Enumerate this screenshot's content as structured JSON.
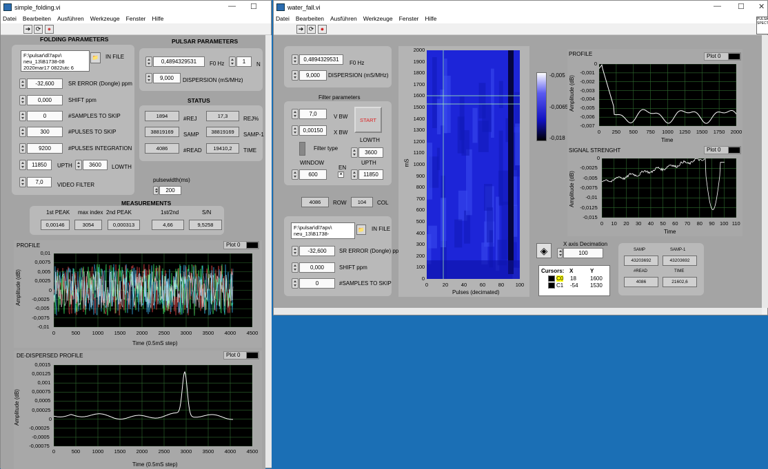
{
  "left_window": {
    "title": "simple_folding.vi",
    "menu": [
      "Datei",
      "Bearbeiten",
      "Ausführen",
      "Werkzeuge",
      "Fenster",
      "Hilfe"
    ],
    "folding": {
      "header": "FOLDING PARAMETERS",
      "in_file_label": "IN FILE",
      "in_file_value": "F:\\pulsar\\dl7apv\\ neu_13\\B1738-08 2020mar17 0822utc 6",
      "sr_error": {
        "value": "-32,600",
        "label": "SR ERROR (Dongle) ppm"
      },
      "shift": {
        "value": "0,000",
        "label": "SHIFT ppm"
      },
      "samples_skip": {
        "value": "0",
        "label": "#SAMPLES TO SKIP"
      },
      "pulses_skip": {
        "value": "300",
        "label": "#PULSES TO SKIP"
      },
      "pulses_int": {
        "value": "9200",
        "label": "#PULSES INTEGRATION"
      },
      "upth": {
        "value": "11850",
        "label": "UPTH"
      },
      "lowth": {
        "value": "3600",
        "label": "LOWTH"
      },
      "video": {
        "value": "7,0",
        "label": "VIDEO FILTER"
      }
    },
    "pulsar": {
      "header": "PULSAR PARAMETERS",
      "f0": {
        "value": "0,4894329531",
        "label": "F0 Hz"
      },
      "n": {
        "value": "1",
        "label": "N"
      },
      "dispersion": {
        "value": "9,000",
        "label": "DISPERSION (mS/MHz)"
      }
    },
    "status": {
      "header": "STATUS",
      "rej": "1894",
      "rej_label": "#REJ",
      "rej_pct": "17,3",
      "rej_pct_label": "REJ%",
      "samp": "38819169",
      "samp_label": "SAMP",
      "samp1": "38819169",
      "samp1_label": "SAMP-1",
      "read": "4086",
      "read_label": "#READ",
      "time": "19410,2",
      "time_label": "TIME"
    },
    "pulsewidth": {
      "label": "pulsewidth(ms)",
      "value": "200"
    },
    "measurements": {
      "header": "MEASUREMENTS",
      "labels": [
        "1st PEAK",
        "max index",
        "2nd PEAK",
        "1st/2nd",
        "S/N"
      ],
      "values": [
        "0,00146",
        "3054",
        "0,000313",
        "4,66",
        "9,5258"
      ]
    },
    "profile": {
      "title": "PROFILE",
      "plot": "Plot 0",
      "ylabel": "Amplitude (dB)",
      "xlabel": "Time (0.5mS step)",
      "yticks": [
        "0,01",
        "0,0075",
        "0,005",
        "0,0025",
        "0",
        "-0,0025",
        "-0,005",
        "-0,0075",
        "-0,01"
      ],
      "xticks": [
        "0",
        "500",
        "1000",
        "1500",
        "2000",
        "2500",
        "3000",
        "3500",
        "4000",
        "4500"
      ]
    },
    "dedispersed": {
      "title": "DE-DISPERSED PROFILE",
      "plot": "Plot 0",
      "ylabel": "Amplitude (dB)",
      "xlabel": "Time (0.5mS step)",
      "yticks": [
        "0,0015",
        "0,00125",
        "0,001",
        "0,00075",
        "0,0005",
        "0,00025",
        "0",
        "-0,00025",
        "-0,0005",
        "-0,00075"
      ],
      "xticks": [
        "0",
        "500",
        "1000",
        "1500",
        "2000",
        "2500",
        "3000",
        "3500",
        "4000",
        "4500"
      ]
    }
  },
  "right_window": {
    "title": "water_fall.vi",
    "menu": [
      "Datei",
      "Bearbeiten",
      "Ausführen",
      "Werkzeuge",
      "Fenster",
      "Hilfe"
    ],
    "corner_label": "PULSAR SPECT",
    "params": {
      "f0": {
        "value": "0,4894329531",
        "label": "F0 Hz"
      },
      "dispersion": {
        "value": "9,000",
        "label": "DISPERSION (mS/MHz)"
      }
    },
    "filter": {
      "header": "Filter parameters",
      "vbw": {
        "value": "7,0",
        "label": "V BW"
      },
      "xbw": {
        "value": "0,00150",
        "label": "X BW"
      },
      "start": "START",
      "lowth_label": "LOWTH",
      "lowth": "3600",
      "type_label": "Filter type",
      "window_label": "WINDOW",
      "window": "600",
      "en_label": "EN",
      "upth_label": "UPTH",
      "upth": "11850"
    },
    "row_col": {
      "row": "4086",
      "row_label": "ROW",
      "col": "104",
      "col_label": "COL"
    },
    "file": {
      "in_file_label": "IN FILE",
      "in_file_value": "F:\\pulsar\\dl7apv\\ neu_13\\B1738-",
      "sr_error": {
        "value": "-32,600",
        "label": "SR ERROR (Dongle) ppm"
      },
      "shift": {
        "value": "0,000",
        "label": "SHIFT ppm"
      },
      "samples_skip": {
        "value": "0",
        "label": "#SAMPLES TO SKIP"
      }
    },
    "waterfall": {
      "ylabel": "mS",
      "xlabel": "Pulses (decimated)",
      "yticks": [
        "2000",
        "1900",
        "1800",
        "1700",
        "1600",
        "1500",
        "1400",
        "1300",
        "1200",
        "1100",
        "1000",
        "900",
        "800",
        "700",
        "600",
        "500",
        "400",
        "300",
        "200",
        "100",
        "0"
      ],
      "xticks": [
        "0",
        "20",
        "40",
        "60",
        "80",
        "100"
      ],
      "colorscale": [
        "-0,005",
        "-0,0065",
        "-0,018"
      ]
    },
    "cursors": {
      "header": "Cursors:",
      "x": "X",
      "y": "Y",
      "rows": [
        {
          "name": "C0",
          "x": "18",
          "y": "1600"
        },
        {
          "name": "C1",
          "x": "-54",
          "y": "1530"
        }
      ]
    },
    "decimation": {
      "label": "X axis Decimation",
      "value": "100"
    },
    "stats": {
      "samp_label": "SAMP",
      "samp": "43203692",
      "samp1_label": "SAMP-1",
      "samp1": "43203692",
      "read_label": "#READ",
      "read": "4086",
      "time_label": "TIME",
      "time": "21602,6"
    },
    "profile": {
      "title": "PROFILE",
      "plot": "Plot 0",
      "ylabel": "Amplitude (dB)",
      "xlabel": "Time",
      "yticks": [
        "0",
        "-0,001",
        "-0,002",
        "-0,003",
        "-0,004",
        "-0,005",
        "-0,006",
        "-0,007"
      ],
      "xticks": [
        "0",
        "250",
        "500",
        "750",
        "1000",
        "1250",
        "1500",
        "1750",
        "2000"
      ]
    },
    "signal": {
      "title": "SIGNAL STRENGHT",
      "plot": "Plot 0",
      "ylabel": "Amplitude (dB)",
      "xlabel": "Time",
      "yticks": [
        "0",
        "-0,0025",
        "-0,005",
        "-0,0075",
        "-0,01",
        "-0,0125",
        "-0,015"
      ],
      "xticks": [
        "0",
        "10",
        "20",
        "30",
        "40",
        "50",
        "60",
        "70",
        "80",
        "90",
        "100",
        "110"
      ]
    }
  },
  "colors": {
    "graph_line_white": "#ffffff",
    "grid": "#2f6b2f",
    "panel": "#a4a4a4",
    "desktop": "#1b6fb5"
  }
}
